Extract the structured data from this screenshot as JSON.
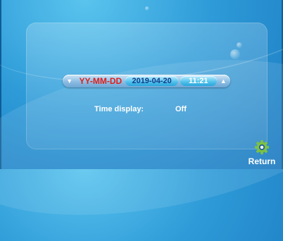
{
  "date_bar": {
    "down_arrow": "▼",
    "format": "YY-MM-DD",
    "date": "2019-04-20",
    "time": "11:21",
    "up_arrow": "▲"
  },
  "time_display": {
    "label": "Time display:",
    "value": "Off"
  },
  "return_button": {
    "label": "Return",
    "icon": "gear-icon"
  },
  "colors": {
    "background": "#2e9bd8",
    "format_text": "#e0201b",
    "date_text": "#123b8a",
    "gear_green": "#7dc242"
  }
}
